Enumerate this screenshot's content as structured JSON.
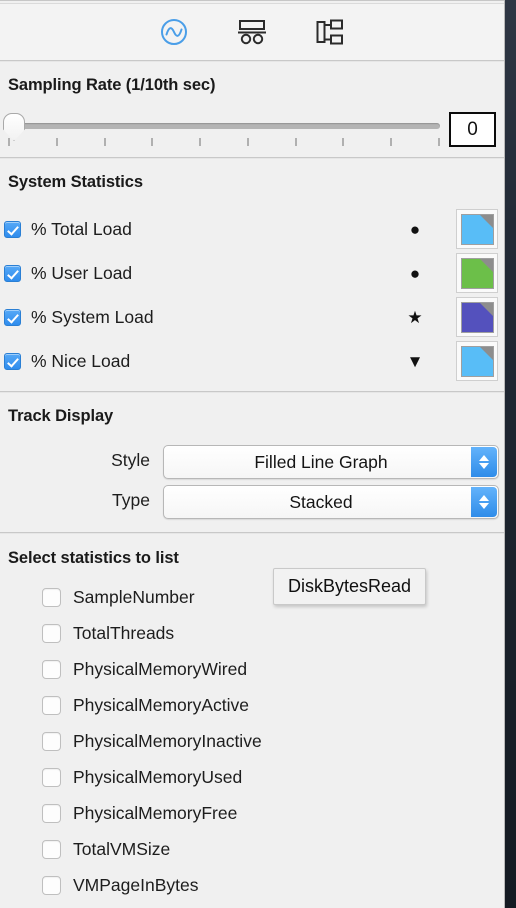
{
  "toolbar": {
    "buttons": [
      {
        "name": "graph-wave-icon",
        "label": "Graph",
        "selected": true
      },
      {
        "name": "table-list-icon",
        "label": "List",
        "selected": false
      },
      {
        "name": "outline-tree-icon",
        "label": "Outline",
        "selected": false
      }
    ],
    "accent": "#2f8ced"
  },
  "sampling": {
    "title": "Sampling Rate (1/10th sec)",
    "value": "0",
    "slider_position_percent": 0,
    "tick_count": 10
  },
  "system_statistics": {
    "title": "System Statistics",
    "rows": [
      {
        "label": "% Total Load",
        "checked": true,
        "marker": "●",
        "marker_name": "circle-marker",
        "color": "#58bdf7"
      },
      {
        "label": "% User Load",
        "checked": true,
        "marker": "●",
        "marker_name": "circle-marker",
        "color": "#6cbf49"
      },
      {
        "label": "% System Load",
        "checked": true,
        "marker": "★",
        "marker_name": "star-marker",
        "color": "#5451bd"
      },
      {
        "label": "% Nice Load",
        "checked": true,
        "marker": "▼",
        "marker_name": "triangle-marker",
        "color": "#58bdf7"
      }
    ]
  },
  "track_display": {
    "title": "Track Display",
    "style": {
      "label": "Style",
      "value": "Filled Line Graph"
    },
    "type": {
      "label": "Type",
      "value": "Stacked"
    }
  },
  "statistics_list": {
    "title": "Select statistics to list",
    "items": [
      {
        "label": "SampleNumber",
        "checked": false
      },
      {
        "label": "TotalThreads",
        "checked": false
      },
      {
        "label": "PhysicalMemoryWired",
        "checked": false
      },
      {
        "label": "PhysicalMemoryActive",
        "checked": false
      },
      {
        "label": "PhysicalMemoryInactive",
        "checked": false
      },
      {
        "label": "PhysicalMemoryUsed",
        "checked": false
      },
      {
        "label": "PhysicalMemoryFree",
        "checked": false
      },
      {
        "label": "TotalVMSize",
        "checked": false
      },
      {
        "label": "VMPageInBytes",
        "checked": false
      }
    ]
  },
  "tooltip": {
    "text": "DiskBytesRead"
  }
}
